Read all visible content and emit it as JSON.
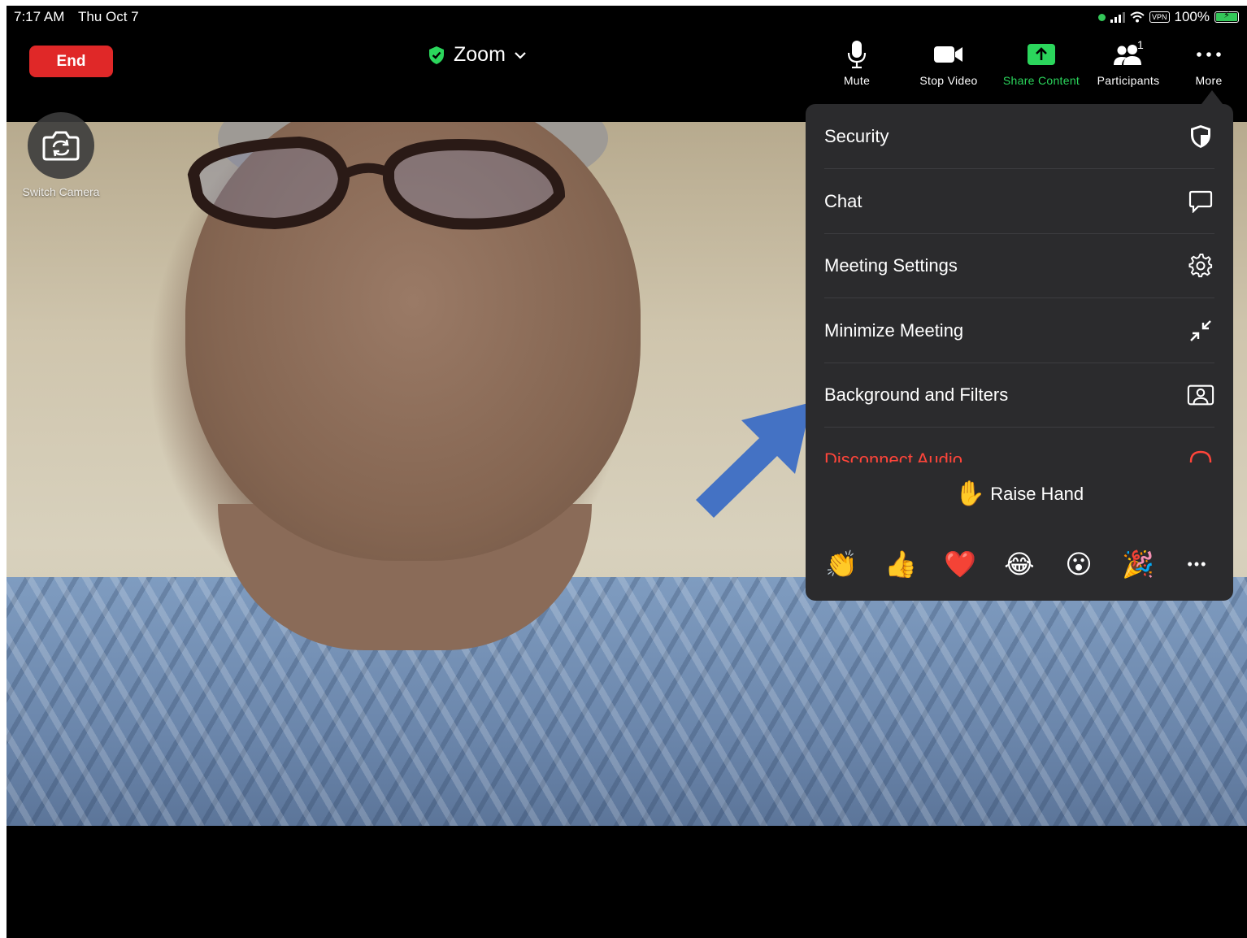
{
  "status_bar": {
    "time": "7:17 AM",
    "date": "Thu Oct 7",
    "vpn": "VPN",
    "battery": "100%"
  },
  "toolbar": {
    "end_label": "End",
    "meeting_title": "Zoom",
    "mute_label": "Mute",
    "stop_video_label": "Stop Video",
    "share_content_label": "Share Content",
    "participants_label": "Participants",
    "participants_count": "1",
    "more_label": "More"
  },
  "video": {
    "switch_camera_label": "Switch Camera"
  },
  "more_menu": {
    "items": [
      {
        "label": "Security",
        "icon": "shield-icon"
      },
      {
        "label": "Chat",
        "icon": "chat-bubble-icon"
      },
      {
        "label": "Meeting Settings",
        "icon": "gear-icon"
      },
      {
        "label": "Minimize Meeting",
        "icon": "minimize-arrows-icon"
      },
      {
        "label": "Background and Filters",
        "icon": "person-frame-icon"
      },
      {
        "label": "Disconnect Audio",
        "icon": "headphones-icon"
      }
    ],
    "raise_hand_emoji": "✋",
    "raise_hand_label": "Raise Hand",
    "reactions": [
      "👏",
      "👍",
      "❤️",
      "😂",
      "😮",
      "🎉"
    ],
    "reactions_more": "•••"
  },
  "colors": {
    "end_button": "#e02828",
    "share_green": "#2bd65c",
    "menu_bg": "#2b2b2d",
    "danger_red": "#ff453a",
    "annotation_arrow": "#4472c4"
  }
}
